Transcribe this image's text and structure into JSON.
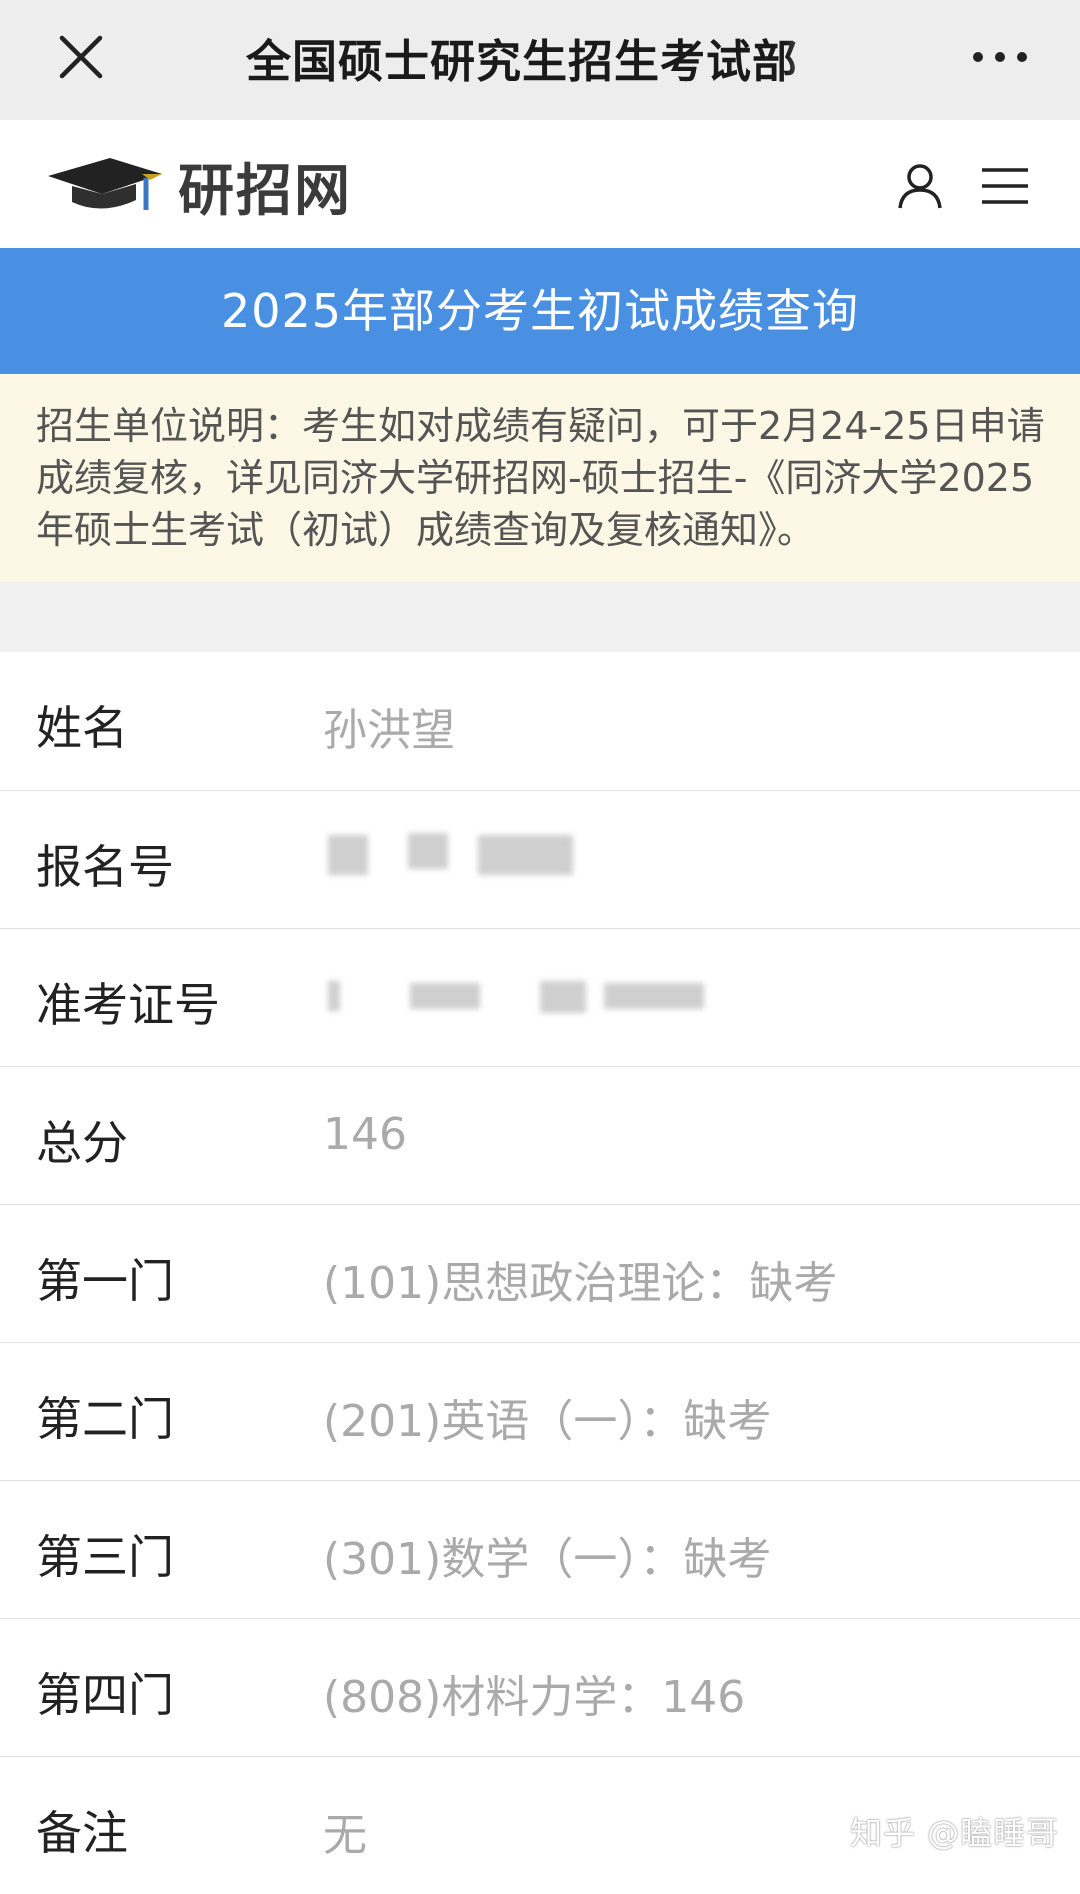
{
  "topbar": {
    "title": "全国硕士研究生招生考试部",
    "close_icon": "close-icon",
    "more_icon": "more-dots-icon"
  },
  "header": {
    "logo_text": "研招网",
    "logo_icon": "graduation-cap-icon",
    "user_icon": "user-icon",
    "menu_icon": "hamburger-menu-icon"
  },
  "banner": {
    "title": "2025年部分考生初试成绩查询",
    "color": "#4a90e2"
  },
  "notice": {
    "text": "招生单位说明：考生如对成绩有疑问，可于2月24-25日申请成绩复核，详见同济大学研招网-硕士招生-《同济大学2025年硕士生考试（初试）成绩查询及复核通知》。",
    "background": "#fdf8e6"
  },
  "rows": [
    {
      "label": "姓名",
      "value": "孙洪望"
    },
    {
      "label": "报名号",
      "value": ""
    },
    {
      "label": "准考证号",
      "value": ""
    },
    {
      "label": "总分",
      "value": "146"
    },
    {
      "label": "第一门",
      "value": "(101)思想政治理论：缺考"
    },
    {
      "label": "第二门",
      "value": "(201)英语（一）：缺考"
    },
    {
      "label": "第三门",
      "value": "(301)数学（一）：缺考"
    },
    {
      "label": "第四门",
      "value": "(808)材料力学：146"
    },
    {
      "label": "备注",
      "value": "无"
    }
  ],
  "watermark": "知乎 @瞌睡哥"
}
